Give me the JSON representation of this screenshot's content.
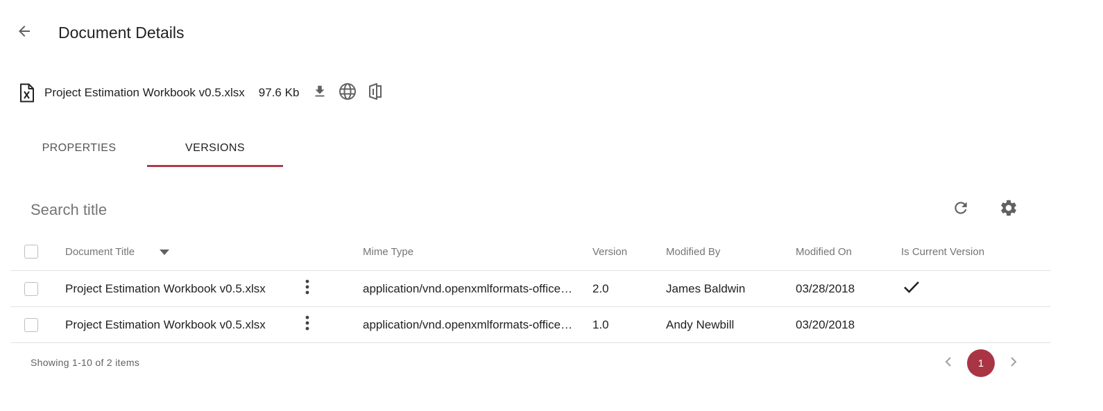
{
  "header": {
    "title": "Document Details",
    "back_icon": "arrow-back-icon"
  },
  "file": {
    "name": "Project Estimation Workbook v0.5.xlsx",
    "size": "97.6 Kb",
    "type_icon": "excel-file-icon",
    "actions": [
      "download-icon",
      "globe-icon",
      "office-icon"
    ]
  },
  "tabs": [
    {
      "label": "PROPERTIES",
      "active": false
    },
    {
      "label": "VERSIONS",
      "active": true
    }
  ],
  "toolbar": {
    "search_placeholder": "Search title",
    "refresh_icon": "refresh-icon",
    "settings_icon": "gear-icon"
  },
  "table": {
    "columns": [
      "Document Title",
      "Mime Type",
      "Version",
      "Modified By",
      "Modified On",
      "Is Current Version"
    ],
    "sort_icon": "sort-descending-icon",
    "rows": [
      {
        "title": "Project Estimation Workbook v0.5.xlsx",
        "mime": "application/vnd.openxmlformats-officedocument.spreadsheetml.sheet",
        "version": "2.0",
        "modified_by": "James Baldwin",
        "modified_on": "03/28/2018",
        "is_current": true
      },
      {
        "title": "Project Estimation Workbook v0.5.xlsx",
        "mime": "application/vnd.openxmlformats-officedocument.spreadsheetml.sheet",
        "version": "1.0",
        "modified_by": "Andy Newbill",
        "modified_on": "03/20/2018",
        "is_current": false
      }
    ]
  },
  "footer": {
    "summary": "Showing 1-10 of 2 items",
    "current_page": "1"
  },
  "colors": {
    "accent": "#b03a48",
    "page_button": "#a93544"
  }
}
